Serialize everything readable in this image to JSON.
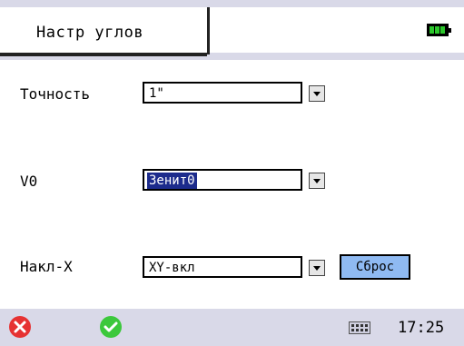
{
  "header": {
    "title": "Настр углов",
    "battery_icon": "battery-full-icon"
  },
  "settings": {
    "accuracy": {
      "label": "Точность",
      "value": "1\""
    },
    "v0": {
      "label": "V0",
      "value": "Зенит0"
    },
    "tilt": {
      "label": "Накл-X",
      "value": "XY-вкл",
      "reset_label": "Сброс"
    }
  },
  "footer": {
    "cancel_icon": "cancel-icon",
    "ok_icon": "ok-icon",
    "keyboard_icon": "keyboard-icon",
    "time": "17:25"
  },
  "colors": {
    "bar_background": "#d9d9e8",
    "selection": "#1c2b8c",
    "reset_button": "#8fbaf2",
    "cancel": "#e63232",
    "ok": "#3cc83c",
    "battery": "#2cc72c"
  }
}
